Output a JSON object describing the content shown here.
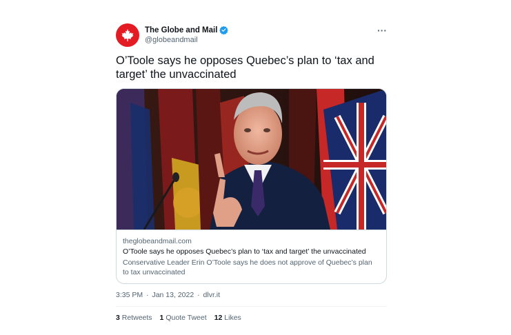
{
  "author": {
    "name": "The Globe and Mail",
    "handle": "@globeandmail",
    "verified": true,
    "avatar_icon": "maple-leaf-icon",
    "avatar_color": "#e31b23"
  },
  "tweet": {
    "text": "O’Toole says he opposes Quebec’s plan to ‘tax and target’ the unvaccinated",
    "more_icon": "more-icon",
    "more_label": "···"
  },
  "card": {
    "domain": "theglobeandmail.com",
    "title": "O’Toole says he opposes Quebec’s plan to ‘tax and target’ the unvaccinated",
    "description": "Conservative Leader Erin O’Toole says he does not approve of Quebec’s plan to tax unvaccinated"
  },
  "meta": {
    "time": "3:35 PM",
    "date": "Jan 13, 2022",
    "source": "dlvr.it",
    "separator": "·"
  },
  "stats": {
    "retweets_count": "3",
    "retweets_label": "Retweets",
    "quotes_count": "1",
    "quotes_label": "Quote Tweet",
    "likes_count": "12",
    "likes_label": "Likes"
  },
  "colors": {
    "verified_blue": "#1d9bf0",
    "secondary_text": "#536471",
    "primary_text": "#0f1419",
    "border": "#cfd9de"
  }
}
